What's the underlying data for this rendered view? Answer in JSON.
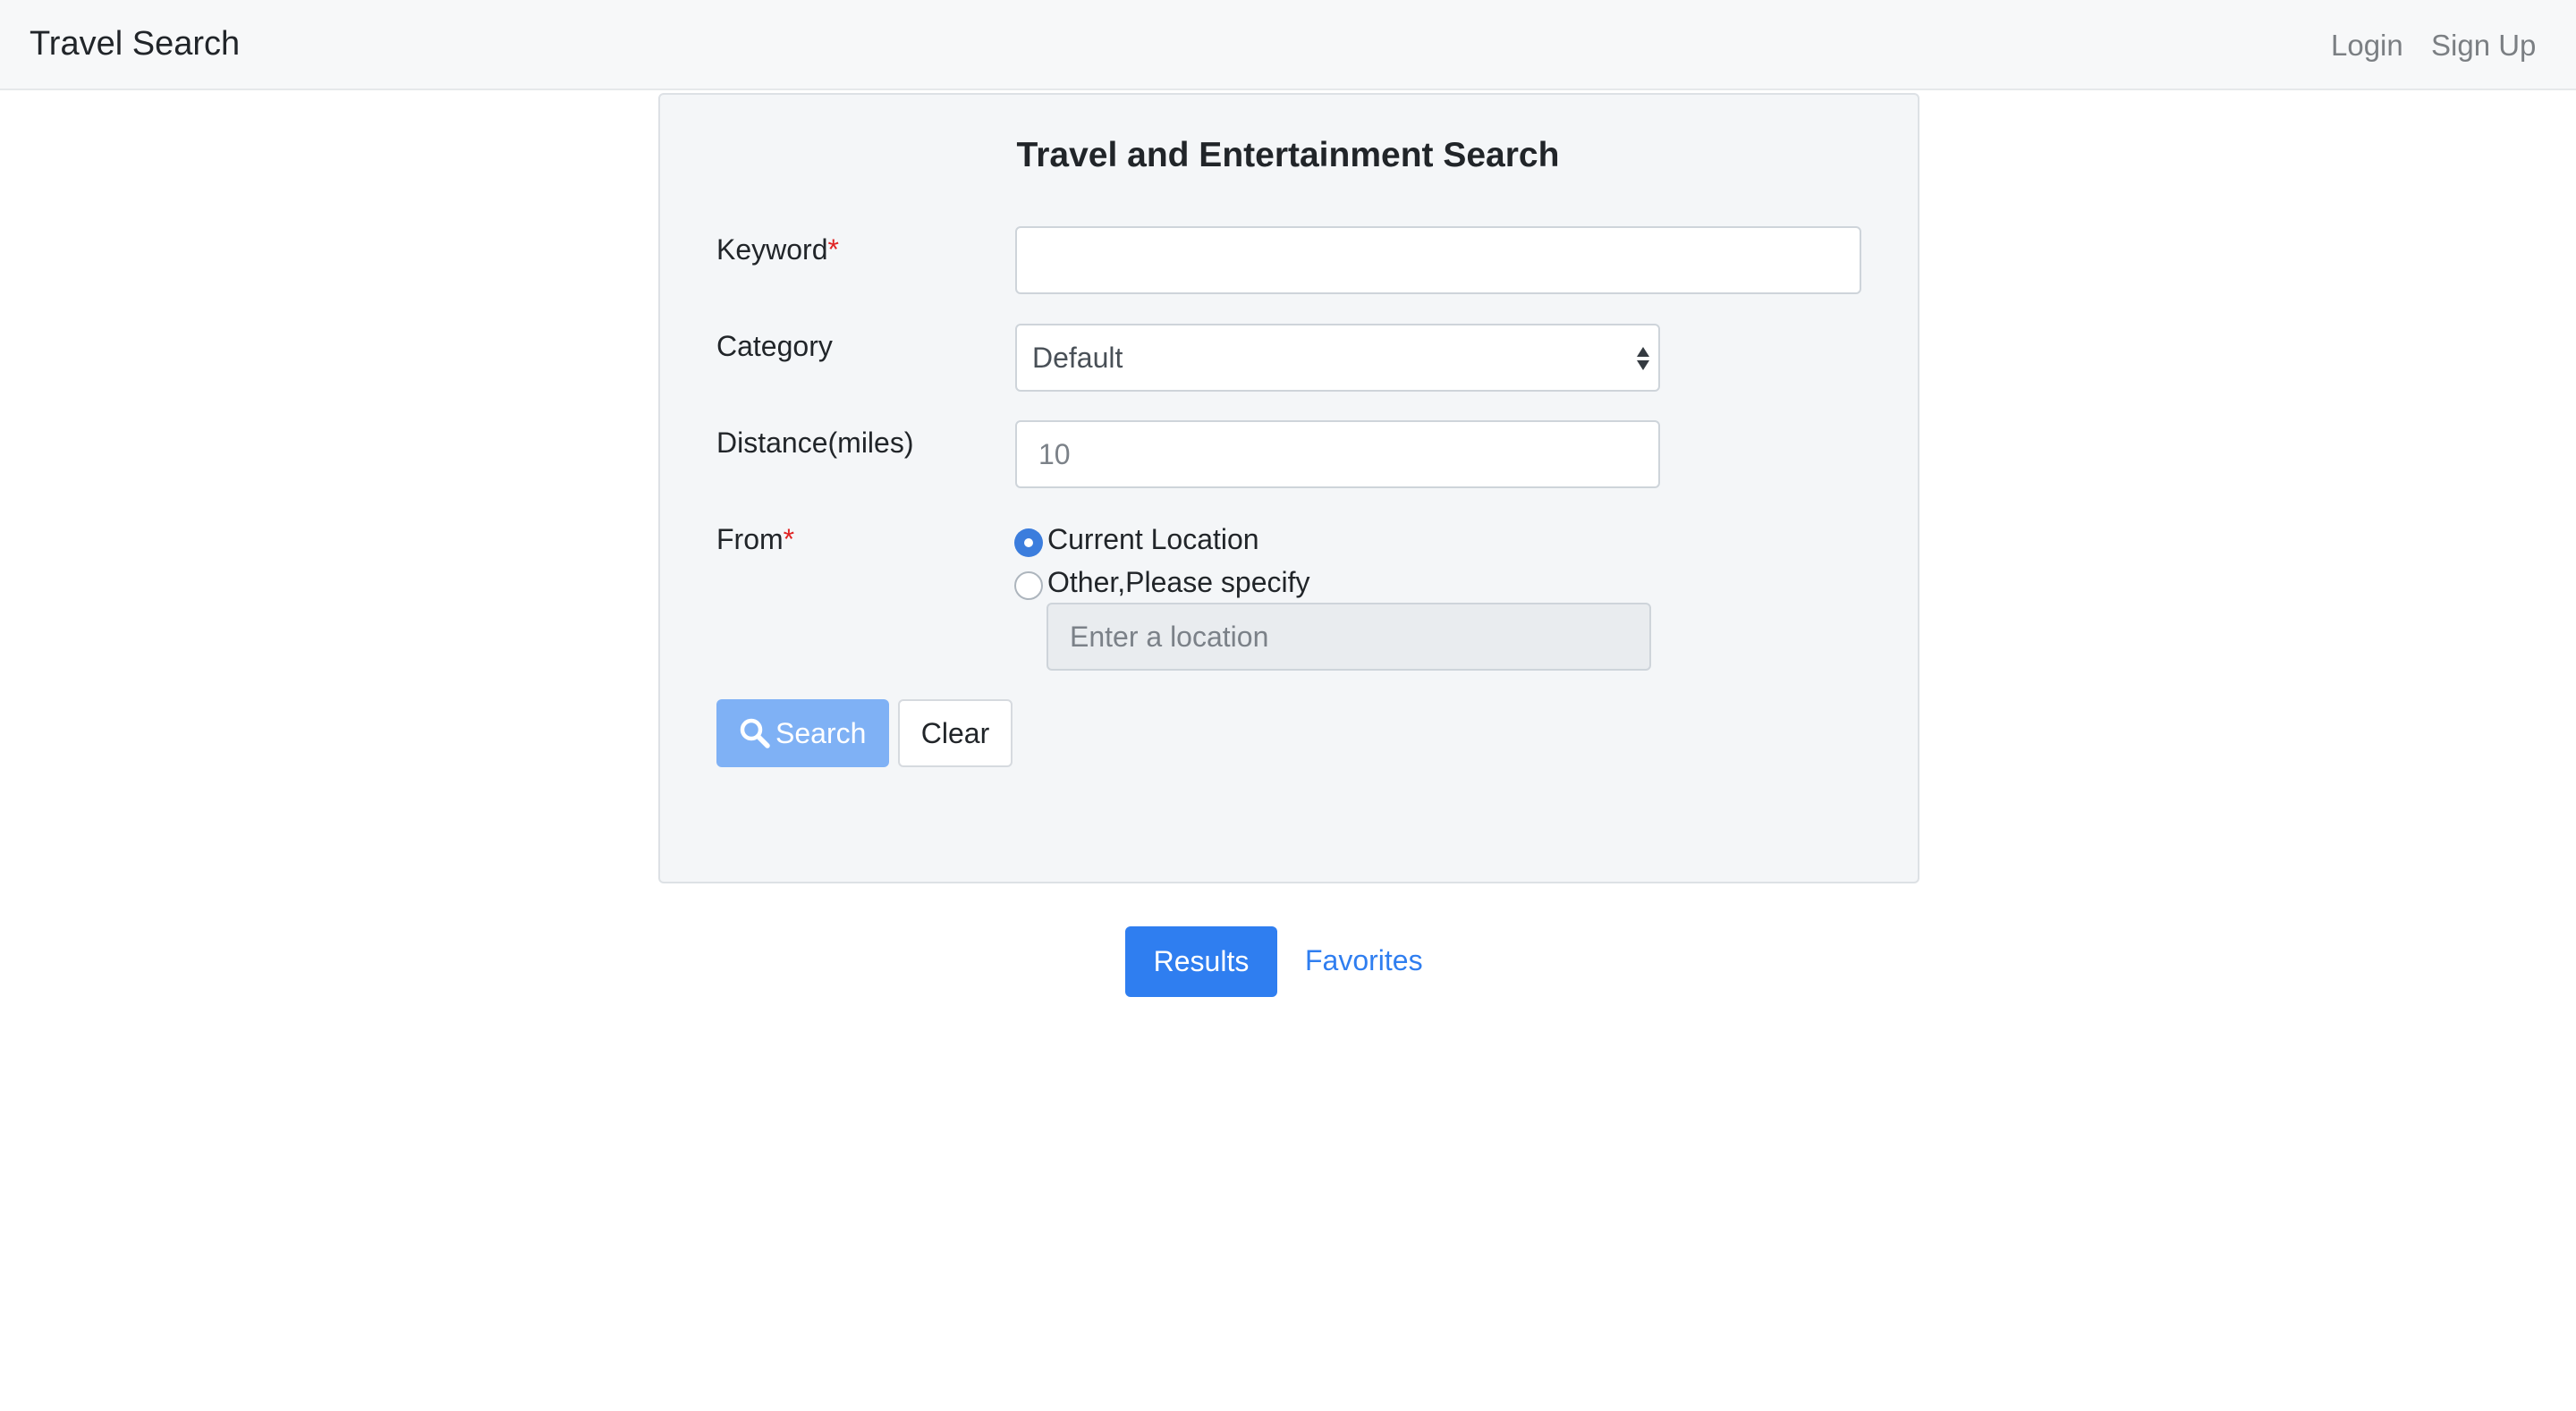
{
  "navbar": {
    "brand": "Travel Search",
    "links": {
      "login": "Login",
      "signup": "Sign Up"
    }
  },
  "form": {
    "title": "Travel and Entertainment Search",
    "keyword": {
      "label": "Keyword",
      "required_mark": "*",
      "value": ""
    },
    "category": {
      "label": "Category",
      "selected": "Default"
    },
    "distance": {
      "label": "Distance(miles)",
      "placeholder": "10",
      "value": ""
    },
    "from": {
      "label": "From",
      "required_mark": "*",
      "options": [
        {
          "label": "Current Location",
          "checked": true
        },
        {
          "label": "Other,Please specify",
          "checked": false
        }
      ],
      "location_placeholder": "Enter a location"
    },
    "buttons": {
      "search": "Search",
      "clear": "Clear"
    }
  },
  "tabs": {
    "results": "Results",
    "favorites": "Favorites"
  },
  "colors": {
    "primary": "#2f7ef0",
    "search_button_disabled": "#7fb1f5",
    "required": "#e02424",
    "card_bg": "#f4f6f8",
    "navbar_bg": "#f7f8f9"
  },
  "icons": {
    "search_button": "search-icon",
    "select": "select-arrows-icon"
  }
}
